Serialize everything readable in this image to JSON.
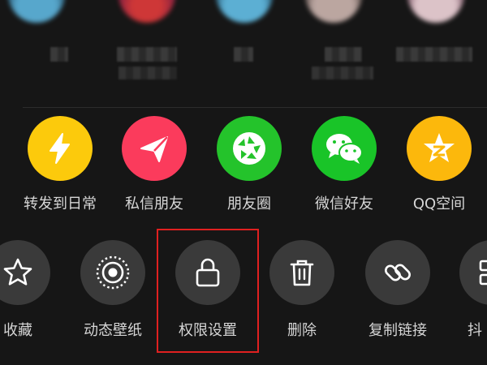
{
  "colors": {
    "background": "#161616",
    "yellow": "#fcca0c",
    "pink": "#fb3b5c",
    "green": "#24c32b",
    "wechat_green": "#19c428",
    "qq_yellow": "#fcb80c",
    "action_circle": "#3a3a3a",
    "highlight": "#e02020"
  },
  "share_targets": [
    {
      "label": "转发到日常",
      "icon": "lightning-icon"
    },
    {
      "label": "私信朋友",
      "icon": "paper-plane-icon"
    },
    {
      "label": "朋友圈",
      "icon": "aperture-icon"
    },
    {
      "label": "微信好友",
      "icon": "wechat-icon"
    },
    {
      "label": "QQ空间",
      "icon": "qzone-star-icon"
    }
  ],
  "actions": [
    {
      "label": "收藏",
      "icon": "star-icon"
    },
    {
      "label": "动态壁纸",
      "icon": "live-wallpaper-icon"
    },
    {
      "label": "权限设置",
      "icon": "lock-icon"
    },
    {
      "label": "删除",
      "icon": "trash-icon"
    },
    {
      "label": "复制链接",
      "icon": "link-icon"
    },
    {
      "label": "抖",
      "icon": "grid-icon"
    }
  ]
}
